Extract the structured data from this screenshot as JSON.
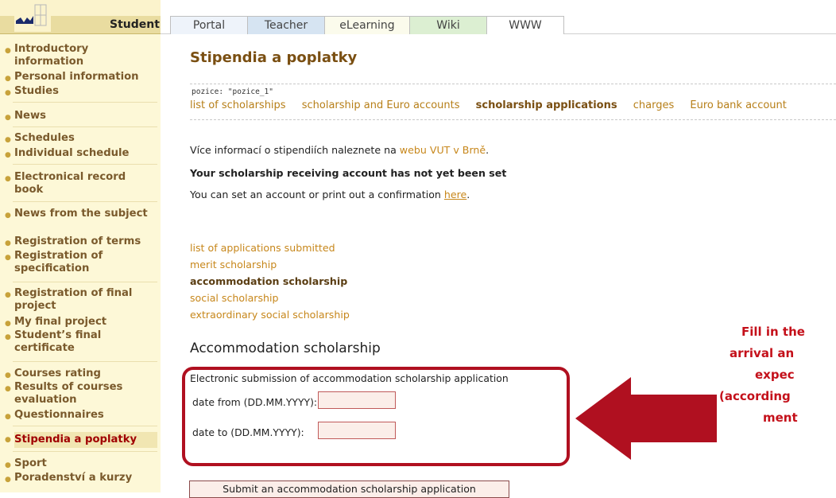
{
  "sidebar": {
    "title": "Student",
    "items": [
      {
        "label": "Introductory information"
      },
      {
        "label": "Personal information"
      },
      {
        "label": "Studies"
      },
      {
        "label": "News"
      },
      {
        "label": "Schedules"
      },
      {
        "label": "Individual schedule"
      },
      {
        "label": "Electronical record book"
      },
      {
        "label": "News from the subject"
      },
      {
        "label": "Registration of terms"
      },
      {
        "label": "Registration of specification"
      },
      {
        "label": "Registration of final project"
      },
      {
        "label": "My final project"
      },
      {
        "label": "Student’s final certificate"
      },
      {
        "label": "Courses rating"
      },
      {
        "label": "Results of courses evaluation"
      },
      {
        "label": "Questionnaires"
      },
      {
        "label": "Stipendia a poplatky"
      },
      {
        "label": "Sport"
      },
      {
        "label": "Poradenství a kurzy"
      }
    ],
    "active_item": "Stipendia a poplatky"
  },
  "tabs": [
    {
      "label": "Portal",
      "color": "#eef3fa"
    },
    {
      "label": "Teacher",
      "color": "#d6e4f2"
    },
    {
      "label": "eLearning",
      "color": "#fbfbec"
    },
    {
      "label": "Wiki",
      "color": "#dcefd2"
    },
    {
      "label": "WWW",
      "color": "#ffffff"
    }
  ],
  "main": {
    "title": "Stipendia a poplatky",
    "position_label": "pozice: \"pozice_1\"",
    "subnav": [
      {
        "label": "list of scholarships"
      },
      {
        "label": "scholarship and Euro accounts"
      },
      {
        "label": "scholarship applications"
      },
      {
        "label": "charges"
      },
      {
        "label": "Euro bank account"
      }
    ],
    "subnav_active": "scholarship applications",
    "info_prefix": "Více informací o stipendiích naleznete na ",
    "info_link": "webu VUT v Brně",
    "info_suffix": ".",
    "account_warning": "Your scholarship receiving account has not yet been set",
    "set_account_prefix": "You can set an account or print out a confirmation ",
    "set_account_link": "here",
    "set_account_suffix": ".",
    "application_links": [
      {
        "label": "list of applications submitted"
      },
      {
        "label": "merit scholarship"
      },
      {
        "label": "accommodation scholarship"
      },
      {
        "label": "social scholarship"
      },
      {
        "label": "extraordinary social scholarship"
      }
    ],
    "active_application": "accommodation scholarship",
    "section_heading": "Accommodation scholarship",
    "form": {
      "title": "Electronic submission of accommodation scholarship application",
      "date_from_label": "date from (DD.MM.YYYY):",
      "date_from_value": "",
      "date_to_label": "date to (DD.MM.YYYY):",
      "date_to_value": "",
      "submit_label": "Submit an accommodation scholarship application"
    }
  },
  "annotation": {
    "lines": [
      "Fill in the",
      "arrival an",
      "expec",
      "(according",
      "ment"
    ],
    "color": "#c4101a"
  }
}
